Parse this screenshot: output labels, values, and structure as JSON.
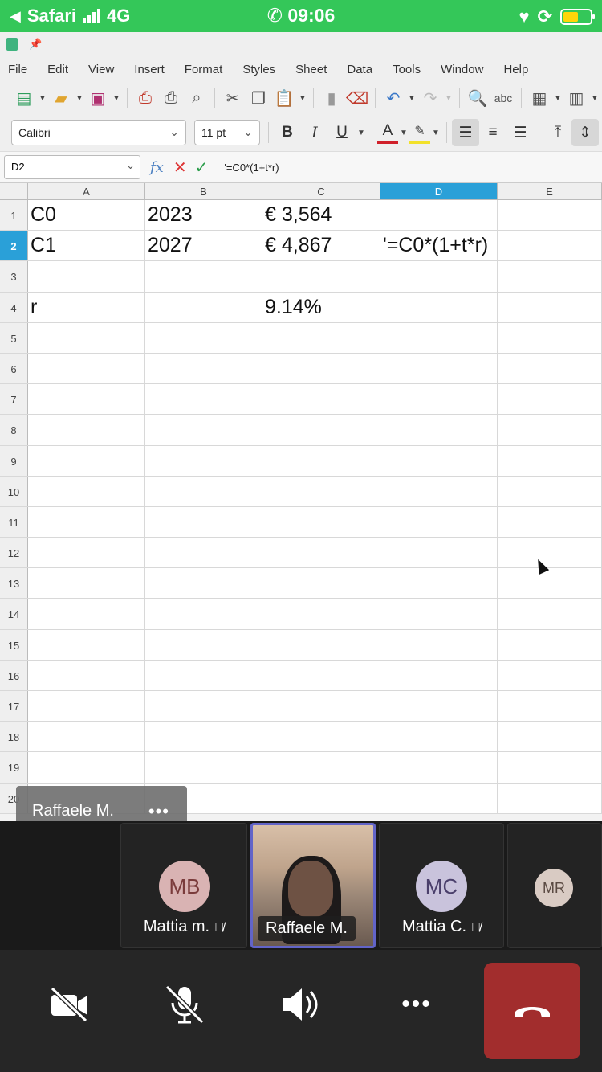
{
  "status_bar": {
    "back_app": "Safari",
    "network": "4G",
    "time": "09:06"
  },
  "menu": [
    "File",
    "Edit",
    "View",
    "Insert",
    "Format",
    "Styles",
    "Sheet",
    "Data",
    "Tools",
    "Window",
    "Help"
  ],
  "toolbar": {
    "font_name": "Calibri",
    "font_size": "11 pt",
    "bold": "B",
    "italic": "I",
    "underline": "U",
    "font_color_glyph": "A"
  },
  "formula_bar": {
    "cell_ref": "D2",
    "fx": "fx",
    "formula": "'=C0*(1+t*r)"
  },
  "sheet": {
    "columns": [
      "A",
      "B",
      "C",
      "D",
      "E"
    ],
    "selected_column": "D",
    "selected_row": 2,
    "rows": [
      {
        "n": "1",
        "cells": [
          "C0",
          "2023",
          "€ 3,564",
          "",
          ""
        ]
      },
      {
        "n": "2",
        "cells": [
          "C1",
          "2027",
          "€ 4,867",
          "'=C0*(1+t*r)",
          ""
        ]
      },
      {
        "n": "3",
        "cells": [
          "",
          "",
          "",
          "",
          ""
        ]
      },
      {
        "n": "4",
        "cells": [
          "r",
          "",
          "9.14%",
          "",
          ""
        ]
      },
      {
        "n": "5",
        "cells": [
          "",
          "",
          "",
          "",
          ""
        ]
      },
      {
        "n": "6",
        "cells": [
          "",
          "",
          "",
          "",
          ""
        ]
      },
      {
        "n": "7",
        "cells": [
          "",
          "",
          "",
          "",
          ""
        ]
      },
      {
        "n": "8",
        "cells": [
          "",
          "",
          "",
          "",
          ""
        ]
      },
      {
        "n": "9",
        "cells": [
          "",
          "",
          "",
          "",
          ""
        ]
      },
      {
        "n": "10",
        "cells": [
          "",
          "",
          "",
          "",
          ""
        ]
      },
      {
        "n": "11",
        "cells": [
          "",
          "",
          "",
          "",
          ""
        ]
      },
      {
        "n": "12",
        "cells": [
          "",
          "",
          "",
          "",
          ""
        ]
      },
      {
        "n": "13",
        "cells": [
          "",
          "",
          "",
          "",
          ""
        ]
      },
      {
        "n": "14",
        "cells": [
          "",
          "",
          "",
          "",
          ""
        ]
      },
      {
        "n": "15",
        "cells": [
          "",
          "",
          "",
          "",
          ""
        ]
      },
      {
        "n": "16",
        "cells": [
          "",
          "",
          "",
          "",
          ""
        ]
      },
      {
        "n": "17",
        "cells": [
          "",
          "",
          "",
          "",
          ""
        ]
      },
      {
        "n": "18",
        "cells": [
          "",
          "",
          "",
          "",
          ""
        ]
      },
      {
        "n": "19",
        "cells": [
          "",
          "",
          "",
          "",
          ""
        ]
      },
      {
        "n": "20",
        "cells": [
          "",
          "",
          "",
          "",
          ""
        ]
      }
    ]
  },
  "presenter_overlay": {
    "name": "Raffaele M.",
    "more": "•••"
  },
  "participants": [
    {
      "initials": "MB",
      "name": "Mattia m.",
      "muted": true,
      "avatar_color": "#d9b3b3",
      "text_color": "#7a3b3b"
    },
    {
      "initials": "",
      "name": "Raffaele M.",
      "muted": false,
      "video": true
    },
    {
      "initials": "MC",
      "name": "Mattia C.",
      "muted": true,
      "avatar_color": "#c9c3dc",
      "text_color": "#4a3f6b"
    },
    {
      "initials": "MR",
      "name": "",
      "muted": false,
      "avatar_color": "#d9cbc3",
      "text_color": "#5a4a42"
    }
  ],
  "controls": {
    "more": "•••"
  },
  "colors": {
    "status_green": "#34c759",
    "selection_blue": "#2aa0d8",
    "hangup_red": "#a22d2d",
    "speaker_border": "#6264c8"
  }
}
